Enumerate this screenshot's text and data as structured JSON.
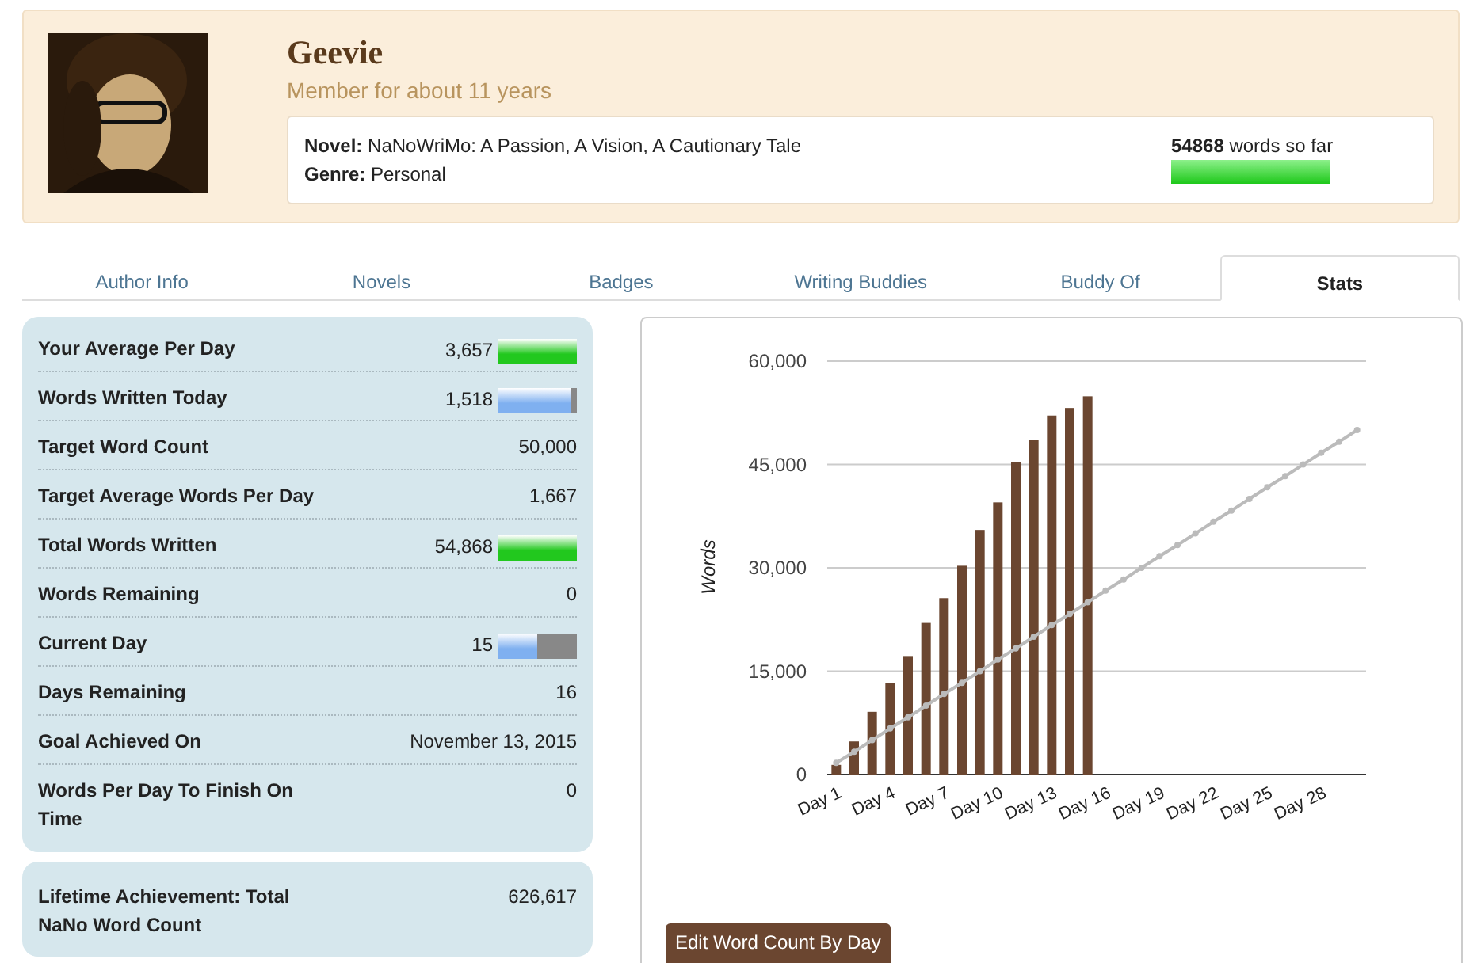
{
  "profile": {
    "name": "Geevie",
    "member_since": "Member for about 11 years",
    "novel_label": "Novel:",
    "novel": "NaNoWriMo: A Passion, A Vision, A Cautionary Tale",
    "genre_label": "Genre:",
    "genre": "Personal",
    "word_count": "54868",
    "word_count_suffix": "words so far",
    "level": 1
  },
  "tabs": [
    {
      "label": "Author Info",
      "selected": false
    },
    {
      "label": "Novels",
      "selected": false
    },
    {
      "label": "Badges",
      "selected": false
    },
    {
      "label": "Writing Buddies",
      "selected": false
    },
    {
      "label": "Buddy Of",
      "selected": false
    },
    {
      "label": "Stats",
      "selected": true
    }
  ],
  "stats": [
    {
      "label": "Your Average Per Day",
      "value": "3,657",
      "kind": "meter",
      "level": 1,
      "color": "#22c81e"
    },
    {
      "label": "Words Written Today",
      "value": "1,518",
      "kind": "meter",
      "level": 0.91,
      "color": "#7fb0f0"
    },
    {
      "label": "Target Word Count",
      "value": "50,000",
      "kind": "plain"
    },
    {
      "label": "Target Average Words Per Day",
      "value": "1,667",
      "kind": "plain"
    },
    {
      "label": "Total Words Written",
      "value": "54,868",
      "kind": "meter",
      "level": 1,
      "color": "#22c81e"
    },
    {
      "label": "Words Remaining",
      "value": "0",
      "kind": "plain"
    },
    {
      "label": "Current Day",
      "value": "15",
      "kind": "meter",
      "level": 0.5,
      "color": "#7fb0f0"
    },
    {
      "label": "Days Remaining",
      "value": "16",
      "kind": "plain"
    },
    {
      "label": "Goal Achieved On",
      "value": "November 13, 2015",
      "kind": "plain"
    },
    {
      "label": "Words Per Day To Finish On Time",
      "value": "0",
      "kind": "plain"
    }
  ],
  "lifetime": {
    "label": "Lifetime Achievement: Total NaNo Word Count",
    "value": "626,617"
  },
  "chart": {
    "chart_data": {
      "type": "bar",
      "ylabel": "Words",
      "categories": [
        "Day 1",
        null,
        null,
        "Day 4",
        null,
        null,
        "Day 7",
        null,
        null,
        "Day 10",
        null,
        null,
        "Day 13",
        null,
        null,
        "Day 16",
        null,
        null,
        "Day 19",
        null,
        null,
        "Day 22",
        null,
        null,
        "Day 25",
        null,
        null,
        "Day 28",
        null,
        null
      ],
      "ylim": [
        0,
        60000
      ],
      "grid": true,
      "yticks": [
        {
          "value": 0,
          "label": "0"
        },
        {
          "value": 15000,
          "label": "15,000"
        },
        {
          "value": 30000,
          "label": "30,000"
        },
        {
          "value": 45000,
          "label": "45,000"
        },
        {
          "value": 60000,
          "label": "60,000"
        }
      ],
      "series": [
        {
          "color": "#6b4630",
          "values": [
            1400,
            4800,
            9100,
            13300,
            17200,
            22000,
            25600,
            30300,
            35500,
            39500,
            45400,
            48600,
            52100,
            53200,
            54900,
            null,
            null,
            null,
            null,
            null,
            null,
            null,
            null,
            null,
            null,
            null,
            null,
            null,
            null,
            null
          ]
        },
        {
          "type": "line",
          "marker": true,
          "color": "#bbbbbb",
          "values": [
            1700,
            3300,
            5000,
            6700,
            8300,
            10000,
            11700,
            13300,
            15000,
            16700,
            18300,
            20000,
            21700,
            23300,
            25000,
            26700,
            28300,
            30000,
            31700,
            33300,
            35000,
            36700,
            38300,
            40000,
            41700,
            43300,
            45000,
            46700,
            48300,
            50000
          ]
        }
      ]
    },
    "button": "Edit Word Count By Day"
  }
}
